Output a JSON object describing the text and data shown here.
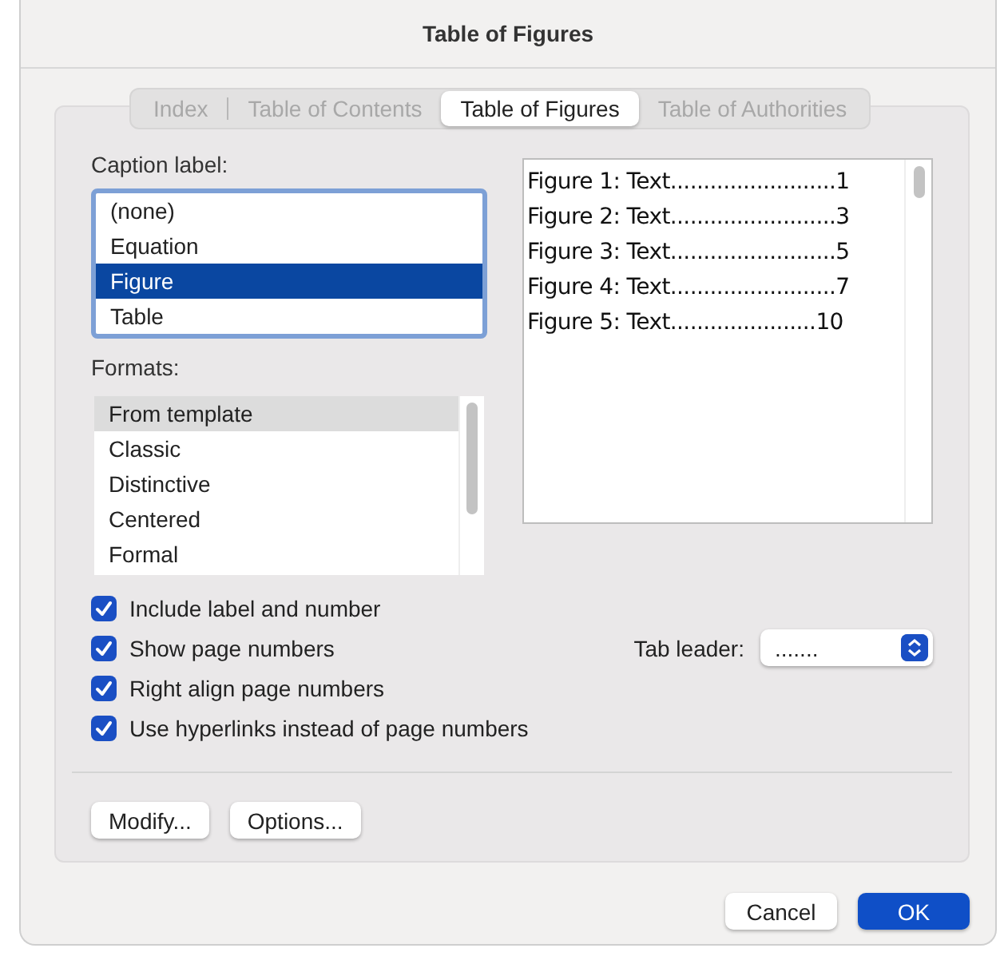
{
  "window": {
    "title": "Table of Figures"
  },
  "tabs": [
    {
      "label": "Index",
      "selected": false
    },
    {
      "label": "Table of Contents",
      "selected": false
    },
    {
      "label": "Table of Figures",
      "selected": true
    },
    {
      "label": "Table of Authorities",
      "selected": false
    }
  ],
  "caption_label": {
    "label": "Caption label:",
    "items": [
      {
        "label": "(none)",
        "selected": false
      },
      {
        "label": "Equation",
        "selected": false
      },
      {
        "label": "Figure",
        "selected": true
      },
      {
        "label": "Table",
        "selected": false
      }
    ]
  },
  "formats": {
    "label": "Formats:",
    "items": [
      {
        "label": "From template",
        "selected": true
      },
      {
        "label": "Classic",
        "selected": false
      },
      {
        "label": "Distinctive",
        "selected": false
      },
      {
        "label": "Centered",
        "selected": false
      },
      {
        "label": "Formal",
        "selected": false
      }
    ]
  },
  "preview": {
    "lines": [
      "Figure 1: Text.........................1",
      "Figure 2: Text.........................3",
      "Figure 3: Text.........................5",
      "Figure 4: Text.........................7",
      "Figure 5: Text......................10"
    ]
  },
  "options": [
    {
      "label": "Include label and number",
      "checked": true
    },
    {
      "label": "Show page numbers",
      "checked": true
    },
    {
      "label": "Right align page numbers",
      "checked": true
    },
    {
      "label": "Use hyperlinks instead of page numbers",
      "checked": true
    }
  ],
  "tab_leader": {
    "label": "Tab leader:",
    "value": "......."
  },
  "buttons": [
    {
      "label": "Modify..."
    },
    {
      "label": "Options..."
    }
  ],
  "footer_buttons": [
    {
      "label": "Cancel",
      "kind": "secondary"
    },
    {
      "label": "OK",
      "kind": "primary"
    }
  ]
}
